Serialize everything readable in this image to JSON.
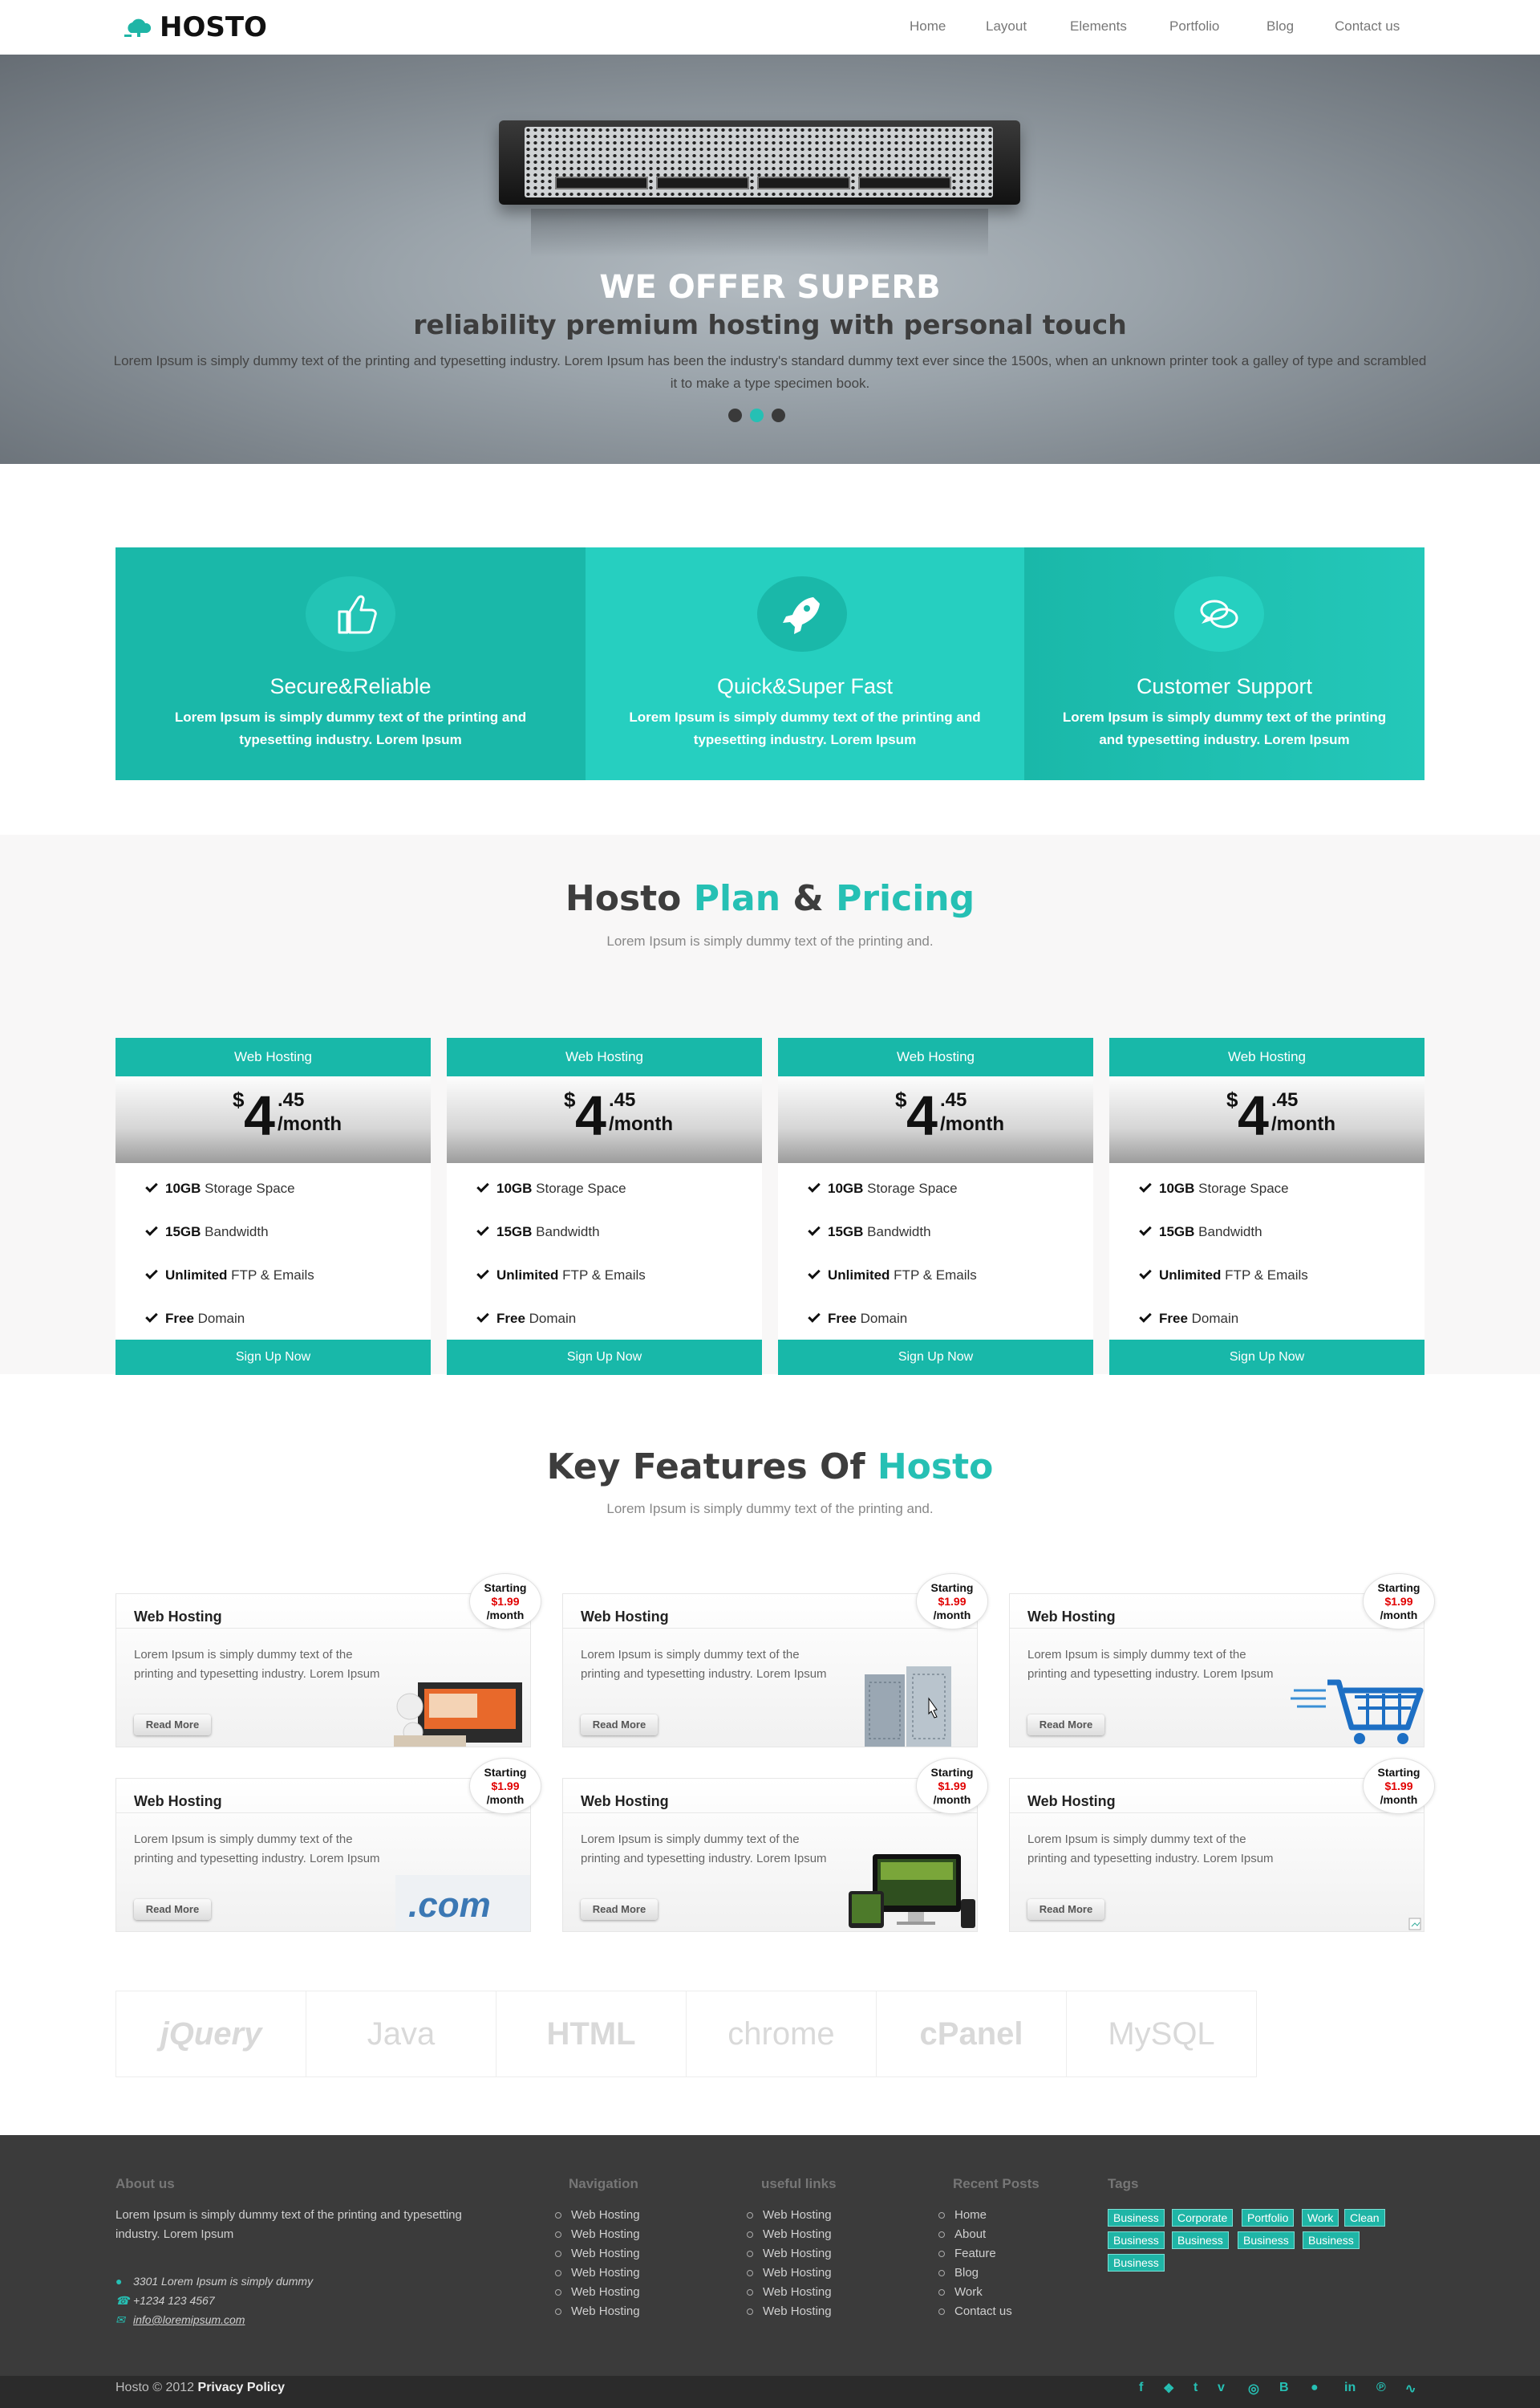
{
  "header": {
    "logo_text": "HOSTO",
    "nav": [
      "Home",
      "Layout",
      "Elements",
      "Portfolio",
      "Blog",
      "Contact us"
    ]
  },
  "hero": {
    "title": "WE OFFER SUPERB",
    "subtitle": "reliability premium hosting with personal touch",
    "text": "Lorem Ipsum is simply dummy text of the printing and typesetting industry. Lorem Ipsum has been the industry's standard dummy text ever since the 1500s, when an unknown printer took a galley of type and scrambled it to make a type specimen book.",
    "slides": 3,
    "active_slide": 2
  },
  "features": [
    {
      "icon": "thumbs-up-icon",
      "title": "Secure&Reliable",
      "text": "Lorem Ipsum is simply dummy text of the printing and typesetting industry. Lorem Ipsum"
    },
    {
      "icon": "rocket-icon",
      "title": "Quick&Super Fast",
      "text": "Lorem Ipsum is simply dummy text of the printing and typesetting industry. Lorem Ipsum"
    },
    {
      "icon": "chat-bubbles-icon",
      "title": "Customer Support",
      "text": "Lorem Ipsum is simply dummy text of the printing and typesetting industry. Lorem Ipsum"
    }
  ],
  "pricing": {
    "title_a": "Hosto ",
    "title_b": "Plan",
    "title_c": " & ",
    "title_d": "Pricing",
    "subtitle": "Lorem Ipsum is simply dummy text of the printing and.",
    "plans": [
      {
        "name": "Web Hosting",
        "currency": "$",
        "dollars": "4",
        "cents": ".45",
        "period": "/month",
        "button": "Sign Up Now"
      },
      {
        "name": "Web Hosting",
        "currency": "$",
        "dollars": "4",
        "cents": ".45",
        "period": "/month",
        "button": "Sign Up Now"
      },
      {
        "name": "Web Hosting",
        "currency": "$",
        "dollars": "4",
        "cents": ".45",
        "period": "/month",
        "button": "Sign Up Now"
      },
      {
        "name": "Web Hosting",
        "currency": "$",
        "dollars": "4",
        "cents": ".45",
        "period": "/month",
        "button": "Sign Up Now"
      }
    ],
    "plan_features": [
      {
        "bold": "10GB",
        "rest": " Storage Space"
      },
      {
        "bold": "15GB",
        "rest": " Bandwidth"
      },
      {
        "bold": "Unlimited",
        "rest": " FTP & Emails"
      },
      {
        "bold": "Free",
        "rest": " Domain"
      }
    ]
  },
  "key_features": {
    "title_a": "Key Features Of ",
    "title_b": "Hosto",
    "subtitle": "Lorem Ipsum is simply dummy text of the printing and.",
    "cards": [
      {
        "title": "Web Hosting",
        "text": "Lorem Ipsum is simply dummy text of the printing and typesetting industry. Lorem Ipsum",
        "button": "Read More",
        "badge_top": "Starting",
        "badge_price": "$1.99",
        "badge_bottom": "/month",
        "image": "website-design-image"
      },
      {
        "title": "Web Hosting",
        "text": "Lorem Ipsum is simply dummy text of the printing and typesetting industry. Lorem Ipsum",
        "button": "Read More",
        "badge_top": "Starting",
        "badge_price": "$1.99",
        "badge_bottom": "/month",
        "image": "server-rack-image"
      },
      {
        "title": "Web Hosting",
        "text": "Lorem Ipsum is simply dummy text of the printing and typesetting industry. Lorem Ipsum",
        "button": "Read More",
        "badge_top": "Starting",
        "badge_price": "$1.99",
        "badge_bottom": "/month",
        "image": "shopping-cart-image"
      },
      {
        "title": "Web Hosting",
        "text": "Lorem Ipsum is simply dummy text of the printing and typesetting industry. Lorem Ipsum",
        "button": "Read More",
        "badge_top": "Starting",
        "badge_price": "$1.99",
        "badge_bottom": "/month",
        "image": "dotcom-image"
      },
      {
        "title": "Web Hosting",
        "text": "Lorem Ipsum is simply dummy text of the printing and typesetting industry. Lorem Ipsum",
        "button": "Read More",
        "badge_top": "Starting",
        "badge_price": "$1.99",
        "badge_bottom": "/month",
        "image": "devices-image"
      },
      {
        "title": "Web Hosting",
        "text": "Lorem Ipsum is simply dummy text of the printing and typesetting industry. Lorem Ipsum",
        "button": "Read More",
        "badge_top": "Starting",
        "badge_price": "$1.99",
        "badge_bottom": "/month",
        "image": "broken-image"
      }
    ]
  },
  "tech_logos": [
    "jQuery",
    "Java",
    "HTML",
    "chrome",
    "cPanel",
    "MySQL"
  ],
  "footer": {
    "about_title": "About us",
    "about_text": "Lorem Ipsum is simply dummy text of the printing and typesetting industry. Lorem Ipsum",
    "address": "3301 Lorem Ipsum is simply dummy",
    "phone": "+1234 123 4567",
    "email": "info@loremipsum.com",
    "navigation_title": "Navigation",
    "navigation": [
      "Web Hosting",
      "Web Hosting",
      "Web Hosting",
      "Web Hosting",
      "Web Hosting",
      "Web Hosting"
    ],
    "useful_title": "useful links",
    "useful": [
      "Web Hosting",
      "Web Hosting",
      "Web Hosting",
      "Web Hosting",
      "Web Hosting",
      "Web Hosting"
    ],
    "recent_title": "Recent Posts",
    "recent": [
      "Home",
      "About",
      "Feature",
      "Blog",
      "Work",
      "Contact us"
    ],
    "tags_title": "Tags",
    "tags": [
      "Business",
      "Corporate",
      "Portfolio",
      "Work",
      "Clean",
      "Business",
      "Business",
      "Business",
      "Business",
      "Business"
    ],
    "copyright": "Hosto © 2012 ",
    "privacy": "Privacy Policy",
    "social": [
      "facebook-icon",
      "twitter-icon",
      "tumblr-icon",
      "vimeo-icon",
      "dribbble-icon",
      "behance-icon",
      "flickr-icon",
      "linkedin-icon",
      "pinterest-icon",
      "rss-icon"
    ]
  },
  "colors": {
    "accent": "#1eb8a9",
    "accent_light": "#26d0c0",
    "footer_bg": "#3b3b3b",
    "price_red": "#e10000"
  }
}
